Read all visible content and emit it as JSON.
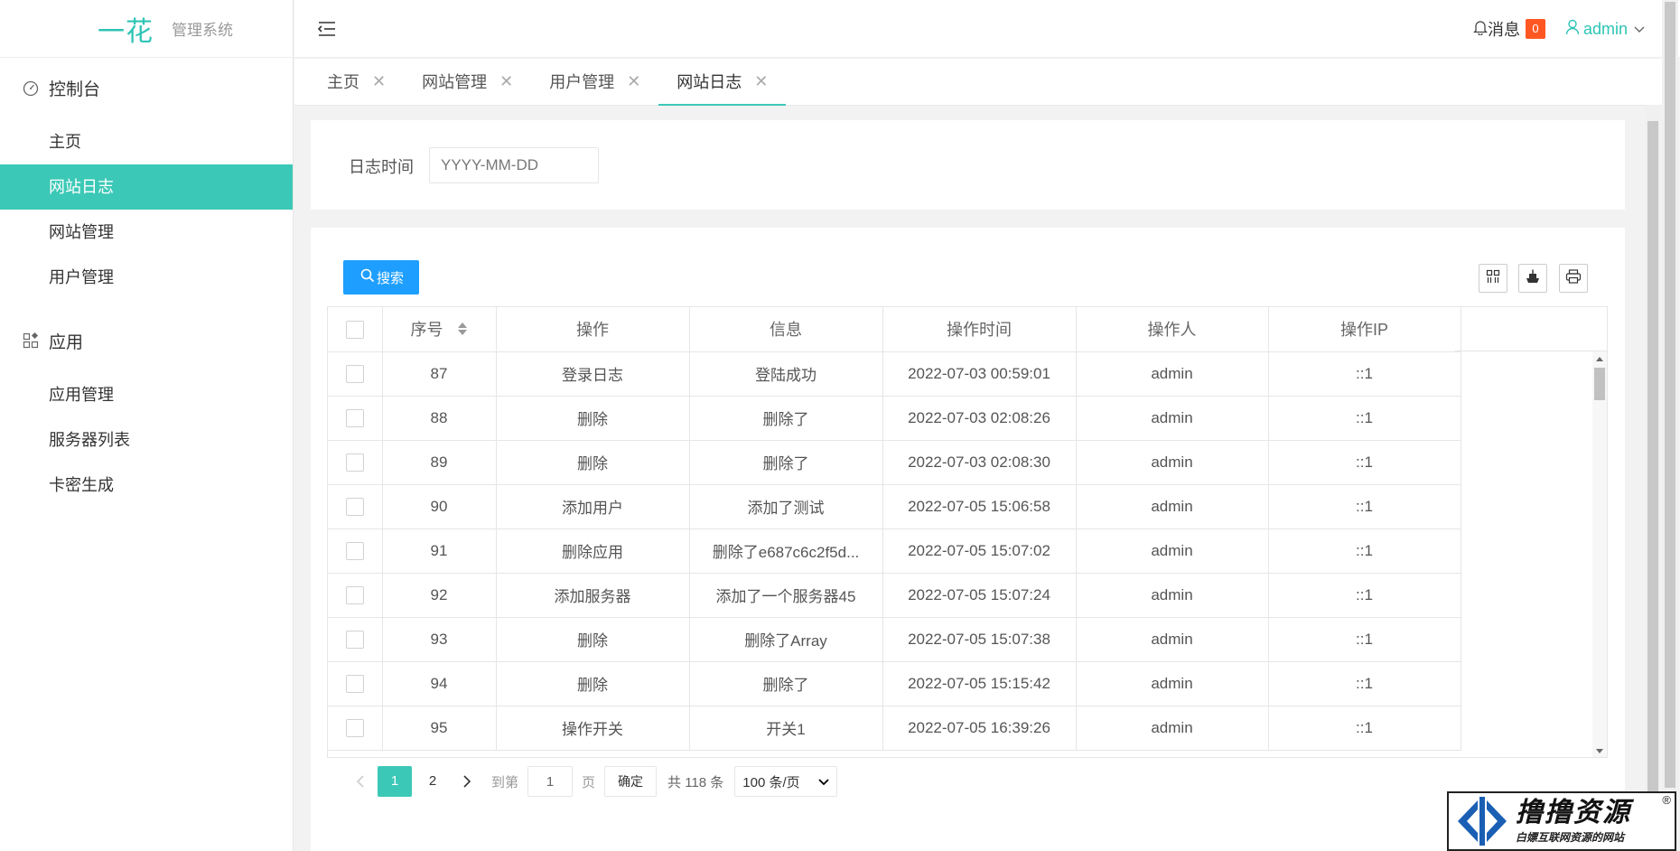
{
  "app": {
    "logo_main": "一花",
    "logo_sub": "管理系统"
  },
  "sidebar": {
    "groups": [
      {
        "label": "控制台",
        "icon": "dashboard-icon",
        "items": [
          {
            "label": "主页",
            "active": false
          },
          {
            "label": "网站日志",
            "active": true
          },
          {
            "label": "网站管理",
            "active": false
          },
          {
            "label": "用户管理",
            "active": false
          }
        ]
      },
      {
        "label": "应用",
        "icon": "apps-icon",
        "items": [
          {
            "label": "应用管理",
            "active": false
          },
          {
            "label": "服务器列表",
            "active": false
          },
          {
            "label": "卡密生成",
            "active": false
          }
        ]
      }
    ]
  },
  "header": {
    "messages_label": "消息",
    "messages_count": "0",
    "user_name": "admin"
  },
  "tabs": [
    {
      "label": "主页",
      "active": false
    },
    {
      "label": "网站管理",
      "active": false
    },
    {
      "label": "用户管理",
      "active": false
    },
    {
      "label": "网站日志",
      "active": true
    }
  ],
  "filter": {
    "label": "日志时间",
    "placeholder": "YYYY-MM-DD"
  },
  "toolbar": {
    "search_label": "搜索"
  },
  "table": {
    "columns": [
      "序号",
      "操作",
      "信息",
      "操作时间",
      "操作人",
      "操作IP"
    ],
    "rows": [
      [
        "87",
        "登录日志",
        "登陆成功",
        "2022-07-03 00:59:01",
        "admin",
        "::1"
      ],
      [
        "88",
        "删除",
        "删除了",
        "2022-07-03 02:08:26",
        "admin",
        "::1"
      ],
      [
        "89",
        "删除",
        "删除了",
        "2022-07-03 02:08:30",
        "admin",
        "::1"
      ],
      [
        "90",
        "添加用户",
        "添加了测试",
        "2022-07-05 15:06:58",
        "admin",
        "::1"
      ],
      [
        "91",
        "删除应用",
        "删除了e687c6c2f5d...",
        "2022-07-05 15:07:02",
        "admin",
        "::1"
      ],
      [
        "92",
        "添加服务器",
        "添加了一个服务器45",
        "2022-07-05 15:07:24",
        "admin",
        "::1"
      ],
      [
        "93",
        "删除",
        "删除了Array",
        "2022-07-05 15:07:38",
        "admin",
        "::1"
      ],
      [
        "94",
        "删除",
        "删除了",
        "2022-07-05 15:15:42",
        "admin",
        "::1"
      ],
      [
        "95",
        "操作开关",
        "开关1",
        "2022-07-05 16:39:26",
        "admin",
        "::1"
      ]
    ]
  },
  "pager": {
    "pages": [
      "1",
      "2"
    ],
    "current": "1",
    "goto_prefix": "到第",
    "goto_value": "1",
    "goto_suffix": "页",
    "confirm_label": "确定",
    "total_text": "共 118 条",
    "page_size": "100 条/页"
  },
  "watermark": {
    "title": "撸撸资源",
    "subtitle": "白嫖互联网资源的网站",
    "reg": "®"
  },
  "colors": {
    "accent": "#3cc8b6",
    "primary_button": "#1e9fff",
    "badge": "#ff5722"
  }
}
